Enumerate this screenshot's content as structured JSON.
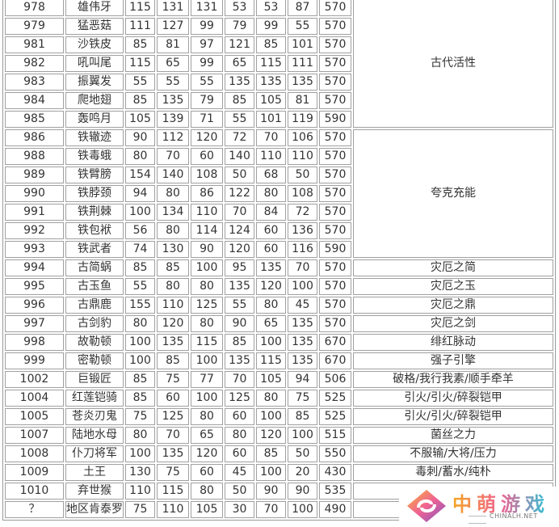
{
  "rows": [
    [
      "978",
      "雄伟牙",
      "115",
      "131",
      "131",
      "53",
      "53",
      "87",
      "570"
    ],
    [
      "979",
      "猛恶菇",
      "111",
      "127",
      "99",
      "79",
      "99",
      "55",
      "570"
    ],
    [
      "981",
      "沙铁皮",
      "85",
      "81",
      "97",
      "121",
      "85",
      "101",
      "570"
    ],
    [
      "982",
      "吼叫尾",
      "115",
      "65",
      "99",
      "65",
      "115",
      "111",
      "570"
    ],
    [
      "983",
      "振翼发",
      "55",
      "55",
      "55",
      "135",
      "135",
      "135",
      "570"
    ],
    [
      "984",
      "爬地翅",
      "85",
      "135",
      "79",
      "85",
      "105",
      "81",
      "570"
    ],
    [
      "985",
      "轰鸣月",
      "105",
      "139",
      "71",
      "55",
      "101",
      "119",
      "590"
    ],
    [
      "986",
      "铁辙迹",
      "90",
      "112",
      "120",
      "72",
      "70",
      "106",
      "570"
    ],
    [
      "988",
      "铁毒蛾",
      "80",
      "70",
      "60",
      "140",
      "110",
      "110",
      "570"
    ],
    [
      "989",
      "铁臂膀",
      "154",
      "140",
      "108",
      "50",
      "68",
      "50",
      "570"
    ],
    [
      "990",
      "铁脖颈",
      "94",
      "80",
      "86",
      "122",
      "80",
      "108",
      "570"
    ],
    [
      "991",
      "铁荆棘",
      "100",
      "134",
      "110",
      "70",
      "84",
      "72",
      "570"
    ],
    [
      "992",
      "铁包袱",
      "56",
      "80",
      "114",
      "124",
      "60",
      "136",
      "570"
    ],
    [
      "993",
      "铁武者",
      "74",
      "130",
      "90",
      "120",
      "60",
      "116",
      "590"
    ],
    [
      "994",
      "古简蜗",
      "85",
      "85",
      "100",
      "95",
      "135",
      "70",
      "570"
    ],
    [
      "995",
      "古玉鱼",
      "55",
      "80",
      "80",
      "135",
      "120",
      "100",
      "570"
    ],
    [
      "996",
      "古鼎鹿",
      "155",
      "110",
      "125",
      "55",
      "80",
      "45",
      "570"
    ],
    [
      "997",
      "古剑豹",
      "80",
      "120",
      "80",
      "90",
      "65",
      "135",
      "570"
    ],
    [
      "998",
      "故勒顿",
      "100",
      "135",
      "115",
      "85",
      "100",
      "135",
      "670"
    ],
    [
      "999",
      "密勒顿",
      "100",
      "85",
      "100",
      "135",
      "115",
      "135",
      "670"
    ],
    [
      "1002",
      "巨锻匠",
      "85",
      "75",
      "77",
      "70",
      "105",
      "94",
      "506"
    ],
    [
      "1004",
      "红莲铠骑",
      "85",
      "60",
      "100",
      "125",
      "80",
      "75",
      "525"
    ],
    [
      "1005",
      "苍炎刃鬼",
      "75",
      "125",
      "80",
      "60",
      "100",
      "85",
      "525"
    ],
    [
      "1007",
      "陆地水母",
      "80",
      "70",
      "65",
      "80",
      "120",
      "100",
      "515"
    ],
    [
      "1008",
      "仆刀将军",
      "100",
      "135",
      "120",
      "60",
      "85",
      "50",
      "550"
    ],
    [
      "1009",
      "土王",
      "130",
      "75",
      "60",
      "45",
      "100",
      "20",
      "430"
    ],
    [
      "1010",
      "弃世猴",
      "110",
      "115",
      "80",
      "50",
      "90",
      "90",
      "535"
    ],
    [
      "？",
      "地区肯泰罗",
      "75",
      "110",
      "105",
      "30",
      "70",
      "100",
      "490"
    ]
  ],
  "abilities": [
    {
      "text": "古代活性",
      "span": 7
    },
    {
      "text": "夸克充能",
      "span": 7
    },
    {
      "text": "灾厄之简",
      "span": 1
    },
    {
      "text": "灾厄之玉",
      "span": 1
    },
    {
      "text": "灾厄之鼎",
      "span": 1
    },
    {
      "text": "灾厄之剑",
      "span": 1
    },
    {
      "text": "绯红脉动",
      "span": 1
    },
    {
      "text": "强子引擎",
      "span": 1
    },
    {
      "text": "破格/我行我素/顺手牵羊",
      "span": 1
    },
    {
      "text": "引火/引火/碎裂铠甲",
      "span": 1
    },
    {
      "text": "引火/引火/碎裂铠甲",
      "span": 1
    },
    {
      "text": "菌丝之力",
      "span": 1
    },
    {
      "text": "不服输/大将/压力",
      "span": 1
    },
    {
      "text": "毒刺/蓄水/纯朴",
      "span": 1
    },
    {
      "text": "",
      "span": 1
    },
    {
      "text": "",
      "span": 1
    }
  ],
  "watermark": {
    "name": "中萌游戏",
    "domain": "CHINALH.NET"
  }
}
